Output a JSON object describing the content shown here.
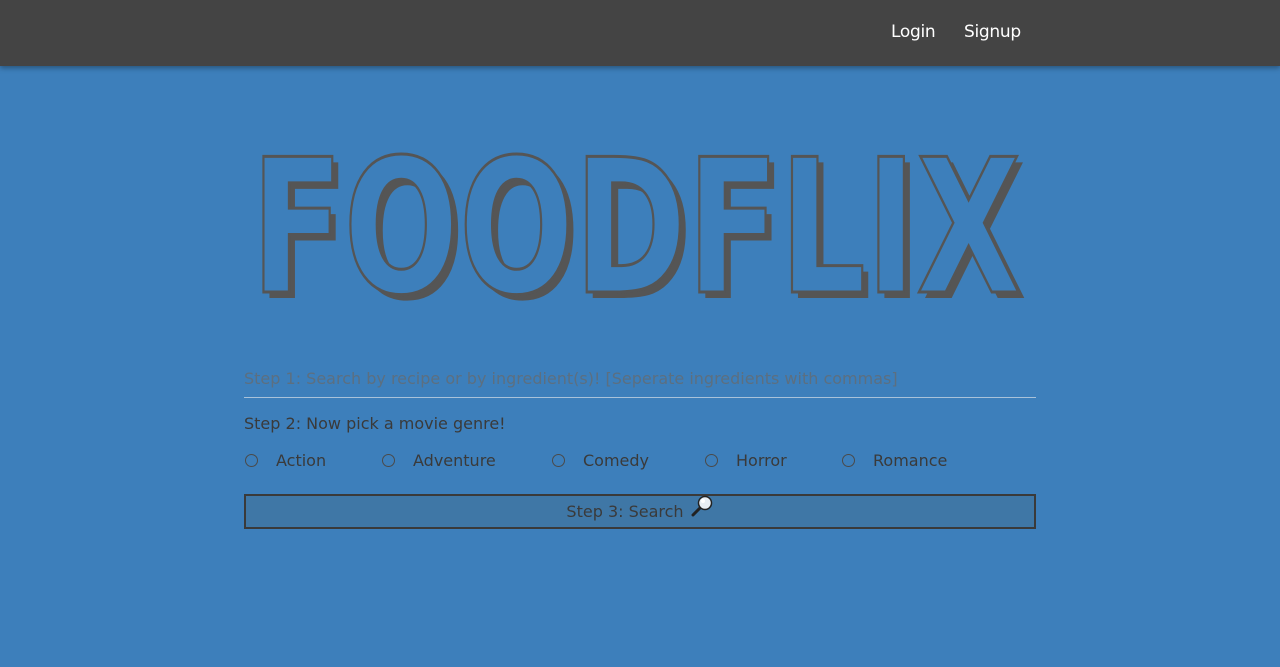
{
  "nav": {
    "login_label": "Login",
    "signup_label": "Signup"
  },
  "logo": {
    "text": "FOODFLIX"
  },
  "search": {
    "placeholder": "Step 1: Search by recipe or by ingredient(s)! [Seperate ingredients with commas]",
    "value": ""
  },
  "step2": {
    "label": "Step 2: Now pick a movie genre!"
  },
  "genres": [
    {
      "label": "Action"
    },
    {
      "label": "Adventure"
    },
    {
      "label": "Comedy"
    },
    {
      "label": "Horror"
    },
    {
      "label": "Romance"
    }
  ],
  "search_button": {
    "label": "Step 3: Search",
    "icon": "magnifying-glass-icon"
  },
  "colors": {
    "page_background": "#3d7fbb",
    "navbar": "#444444",
    "logo_ink": "#555555"
  }
}
